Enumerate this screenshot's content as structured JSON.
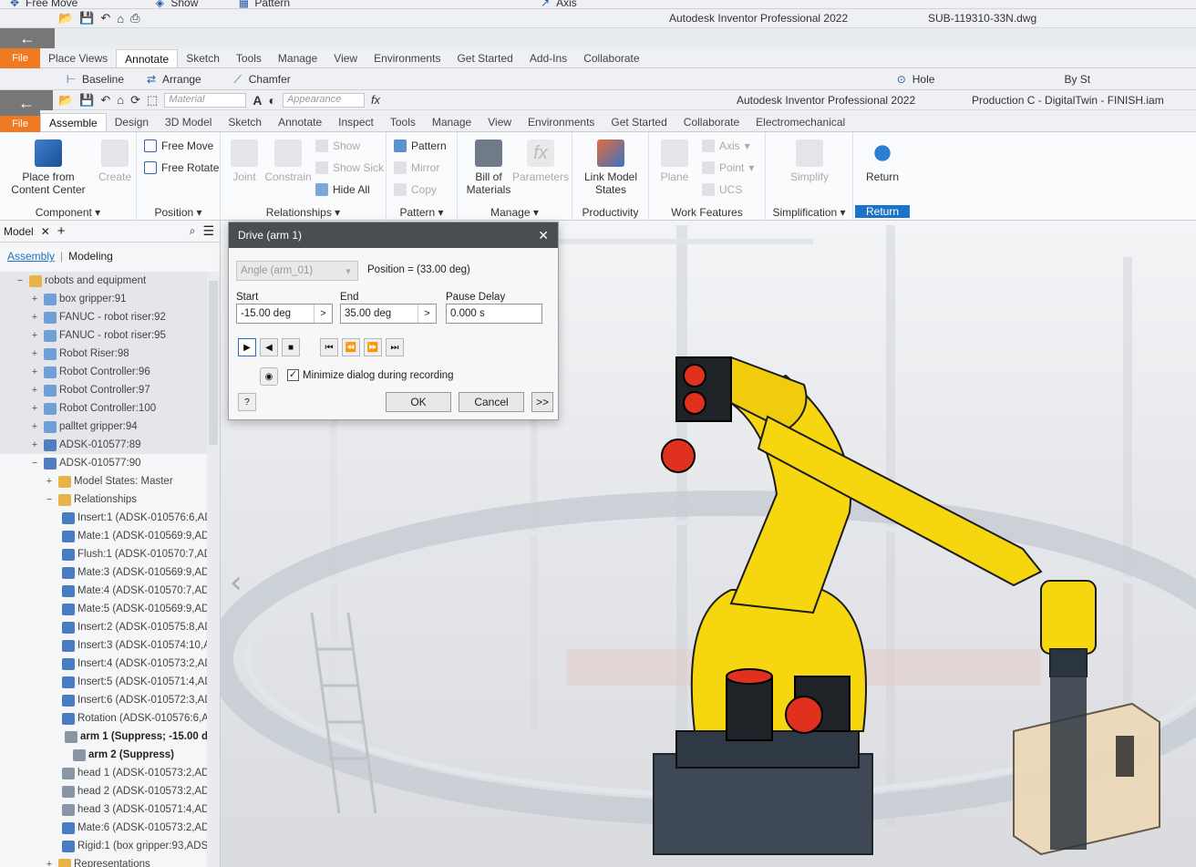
{
  "bg_window": {
    "top_strip": [
      "Free Move",
      "Show",
      "Pattern",
      "Axis"
    ],
    "title": "Autodesk Inventor Professional 2022",
    "file": "SUB-119310-33N.dwg",
    "file_label": "File",
    "tabs": [
      "Place Views",
      "Annotate",
      "Sketch",
      "Tools",
      "Manage",
      "View",
      "Environments",
      "Get Started",
      "Add-Ins",
      "Collaborate"
    ],
    "active_tab": "Annotate",
    "ribbon_items": [
      "Baseline",
      "Arrange",
      "Chamfer",
      "Hole",
      "By St"
    ]
  },
  "window": {
    "title": "Autodesk Inventor Professional 2022",
    "file": "Production C - DigitalTwin - FINISH.iam",
    "file_label": "File",
    "material_placeholder": "Material",
    "appearance_placeholder": "Appearance"
  },
  "tabs": [
    "Assemble",
    "Design",
    "3D Model",
    "Sketch",
    "Annotate",
    "Inspect",
    "Tools",
    "Manage",
    "View",
    "Environments",
    "Get Started",
    "Collaborate",
    "Electromechanical"
  ],
  "ribbon": {
    "component": {
      "title": "Component",
      "place": "Place from",
      "place2": "Content Center",
      "create": "Create"
    },
    "position": {
      "title": "Position",
      "free_move": "Free Move",
      "free_rotate": "Free Rotate"
    },
    "relationships": {
      "title": "Relationships",
      "joint": "Joint",
      "constrain": "Constrain",
      "show": "Show",
      "show_sick": "Show Sick",
      "hide_all": "Hide All"
    },
    "pattern": {
      "title": "Pattern",
      "pattern": "Pattern",
      "mirror": "Mirror",
      "copy": "Copy"
    },
    "manage": {
      "title": "Manage",
      "bom": "Bill of",
      "bom2": "Materials",
      "parameters": "Parameters"
    },
    "productivity": {
      "title": "Productivity",
      "link": "Link Model",
      "link2": "States"
    },
    "work_features": {
      "title": "Work Features",
      "plane": "Plane",
      "axis": "Axis",
      "point": "Point",
      "ucs": "UCS"
    },
    "simplification": {
      "title": "Simplification",
      "simplify": "Simplify"
    },
    "return": {
      "title": "Return",
      "label": "Return"
    }
  },
  "browser": {
    "title": "Model",
    "tab_assembly": "Assembly",
    "tab_modeling": "Modeling",
    "nodes": [
      {
        "label": "robots and equipment",
        "indent": 0,
        "exp": "−",
        "icon": "folder",
        "shade": true
      },
      {
        "label": "box gripper:91",
        "indent": 1,
        "exp": "+",
        "icon": "part",
        "shade": true
      },
      {
        "label": "FANUC - robot riser:92",
        "indent": 1,
        "exp": "+",
        "icon": "part",
        "shade": true
      },
      {
        "label": "FANUC - robot riser:95",
        "indent": 1,
        "exp": "+",
        "icon": "part",
        "shade": true
      },
      {
        "label": "Robot Riser:98",
        "indent": 1,
        "exp": "+",
        "icon": "part",
        "shade": true
      },
      {
        "label": "Robot Controller:96",
        "indent": 1,
        "exp": "+",
        "icon": "part",
        "shade": true
      },
      {
        "label": "Robot Controller:97",
        "indent": 1,
        "exp": "+",
        "icon": "part",
        "shade": true
      },
      {
        "label": "Robot Controller:100",
        "indent": 1,
        "exp": "+",
        "icon": "part",
        "shade": true
      },
      {
        "label": "palltet gripper:94",
        "indent": 1,
        "exp": "+",
        "icon": "part",
        "shade": true
      },
      {
        "label": "ADSK-010577:89",
        "indent": 1,
        "exp": "+",
        "icon": "asm",
        "shade": true
      },
      {
        "label": "ADSK-010577:90",
        "indent": 1,
        "exp": "−",
        "icon": "asm"
      },
      {
        "label": "Model States: Master",
        "indent": 2,
        "exp": "+",
        "icon": "folder"
      },
      {
        "label": "Relationships",
        "indent": 2,
        "exp": "−",
        "icon": "folder"
      },
      {
        "label": "Insert:1 (ADSK-010576:6,AD",
        "indent": 3,
        "exp": "",
        "icon": "rel"
      },
      {
        "label": "Mate:1 (ADSK-010569:9,ADS",
        "indent": 3,
        "exp": "",
        "icon": "rel"
      },
      {
        "label": "Flush:1 (ADSK-010570:7,ADS",
        "indent": 3,
        "exp": "",
        "icon": "rel"
      },
      {
        "label": "Mate:3 (ADSK-010569:9,ADS",
        "indent": 3,
        "exp": "",
        "icon": "rel"
      },
      {
        "label": "Mate:4 (ADSK-010570:7,ADS",
        "indent": 3,
        "exp": "",
        "icon": "rel"
      },
      {
        "label": "Mate:5 (ADSK-010569:9,ADS",
        "indent": 3,
        "exp": "",
        "icon": "rel"
      },
      {
        "label": "Insert:2 (ADSK-010575:8,AD",
        "indent": 3,
        "exp": "",
        "icon": "rel"
      },
      {
        "label": "Insert:3 (ADSK-010574:10,A",
        "indent": 3,
        "exp": "",
        "icon": "rel"
      },
      {
        "label": "Insert:4 (ADSK-010573:2,AD",
        "indent": 3,
        "exp": "",
        "icon": "rel"
      },
      {
        "label": "Insert:5 (ADSK-010571:4,AD",
        "indent": 3,
        "exp": "",
        "icon": "rel"
      },
      {
        "label": "Insert:6 (ADSK-010572:3,AD",
        "indent": 3,
        "exp": "",
        "icon": "rel"
      },
      {
        "label": "Rotation (ADSK-010576:6,AD",
        "indent": 3,
        "exp": "",
        "icon": "rel"
      },
      {
        "label": "arm 1 (Suppress; -15.00 d",
        "indent": 3,
        "exp": "",
        "icon": "angle",
        "bold": true
      },
      {
        "label": "arm 2 (Suppress)",
        "indent": 3,
        "exp": "",
        "icon": "angle",
        "bold": true
      },
      {
        "label": "head 1 (ADSK-010573:2,ADS",
        "indent": 3,
        "exp": "",
        "icon": "angle"
      },
      {
        "label": "head 2 (ADSK-010573:2,ADS",
        "indent": 3,
        "exp": "",
        "icon": "angle"
      },
      {
        "label": "head 3 (ADSK-010571:4,ADS",
        "indent": 3,
        "exp": "",
        "icon": "angle"
      },
      {
        "label": "Mate:6 (ADSK-010573:2,ADS",
        "indent": 3,
        "exp": "",
        "icon": "rel"
      },
      {
        "label": "Rigid:1 (box gripper:93,ADSK",
        "indent": 3,
        "exp": "",
        "icon": "rel"
      },
      {
        "label": "Representations",
        "indent": 2,
        "exp": "+",
        "icon": "folder"
      }
    ]
  },
  "dialog": {
    "title": "Drive (arm 1)",
    "select_value": "Angle (arm_01)",
    "position": "Position = (33.00 deg)",
    "start_label": "Start",
    "start_value": "-15.00 deg",
    "end_label": "End",
    "end_value": "35.00 deg",
    "pause_label": "Pause Delay",
    "pause_value": "0.000 s",
    "minimize_label": "Minimize dialog during recording",
    "ok": "OK",
    "cancel": "Cancel",
    "more": ">>",
    "help": "?"
  },
  "colors": {
    "accent": "#1a73c7",
    "file_orange": "#f07a22",
    "robot_yellow": "#f5d60f",
    "motor_red": "#e0301e"
  }
}
